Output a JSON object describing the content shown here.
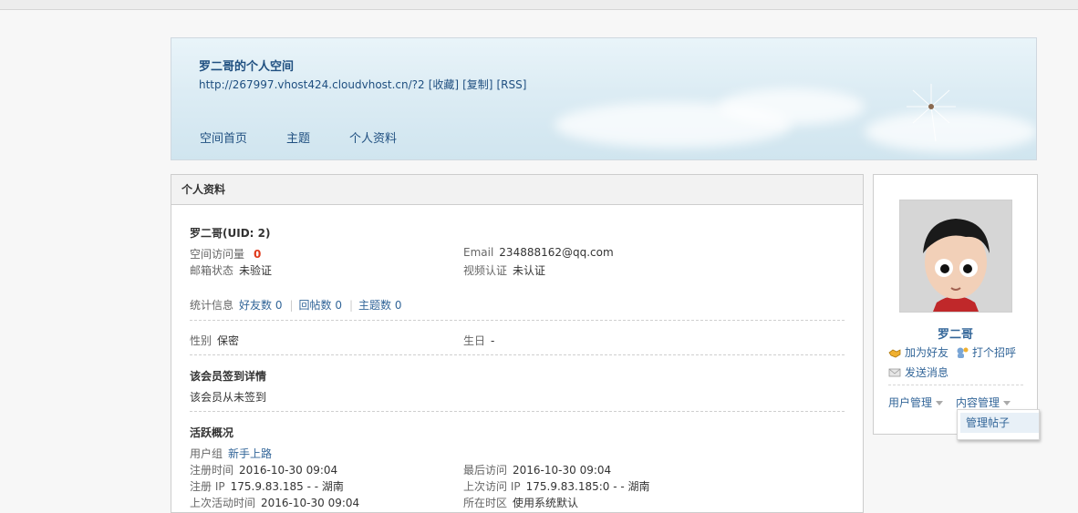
{
  "banner": {
    "title": "罗二哥的个人空间",
    "url": "http://267997.vhost424.cloudvhost.cn/?2",
    "links": [
      "[收藏]",
      "[复制]",
      "[RSS]"
    ],
    "nav": [
      "空间首页",
      "主题",
      "个人资料"
    ]
  },
  "profile": {
    "header": "个人资料",
    "name_uid": "罗二哥(UID: 2)",
    "visits_label": "空间访问量",
    "visits_value": "0",
    "email_label": "Email",
    "email_value": "234888162@qq.com",
    "mail_status_label": "邮箱状态",
    "mail_status_value": "未验证",
    "video_label": "视频认证",
    "video_value": "未认证",
    "stats_label": "统计信息",
    "stats": [
      "好友数 0",
      "回帖数 0",
      "主题数 0"
    ],
    "gender_label": "性别",
    "gender_value": "保密",
    "birthday_label": "生日",
    "birthday_value": "-",
    "signin_title": "该会员签到详情",
    "signin_text": "该会员从未签到",
    "activity_title": "活跃概况",
    "group_label": "用户组",
    "group_value": "新手上路",
    "reg_time_label": "注册时间",
    "reg_time_value": "2016-10-30 09:04",
    "last_visit_label": "最后访问",
    "last_visit_value": "2016-10-30 09:04",
    "reg_ip_label": "注册 IP",
    "reg_ip_value": "175.9.83.185 - - 湖南",
    "last_ip_label": "上次访问 IP",
    "last_ip_value": "175.9.83.185:0 - - 湖南",
    "last_active_label": "上次活动时间",
    "last_active_value": "2016-10-30 09:04",
    "timezone_label": "所在时区",
    "timezone_value": "使用系统默认"
  },
  "sidebar": {
    "username": "罗二哥",
    "add_friend": "加为好友",
    "greet": "打个招呼",
    "send_message": "发送消息",
    "user_manage": "用户管理",
    "content_manage": "内容管理",
    "dropdown_item": "管理帖子"
  },
  "colors": {
    "link": "#336699",
    "accent_red": "#e0391a",
    "banner_sky": "#d0e5ef"
  }
}
